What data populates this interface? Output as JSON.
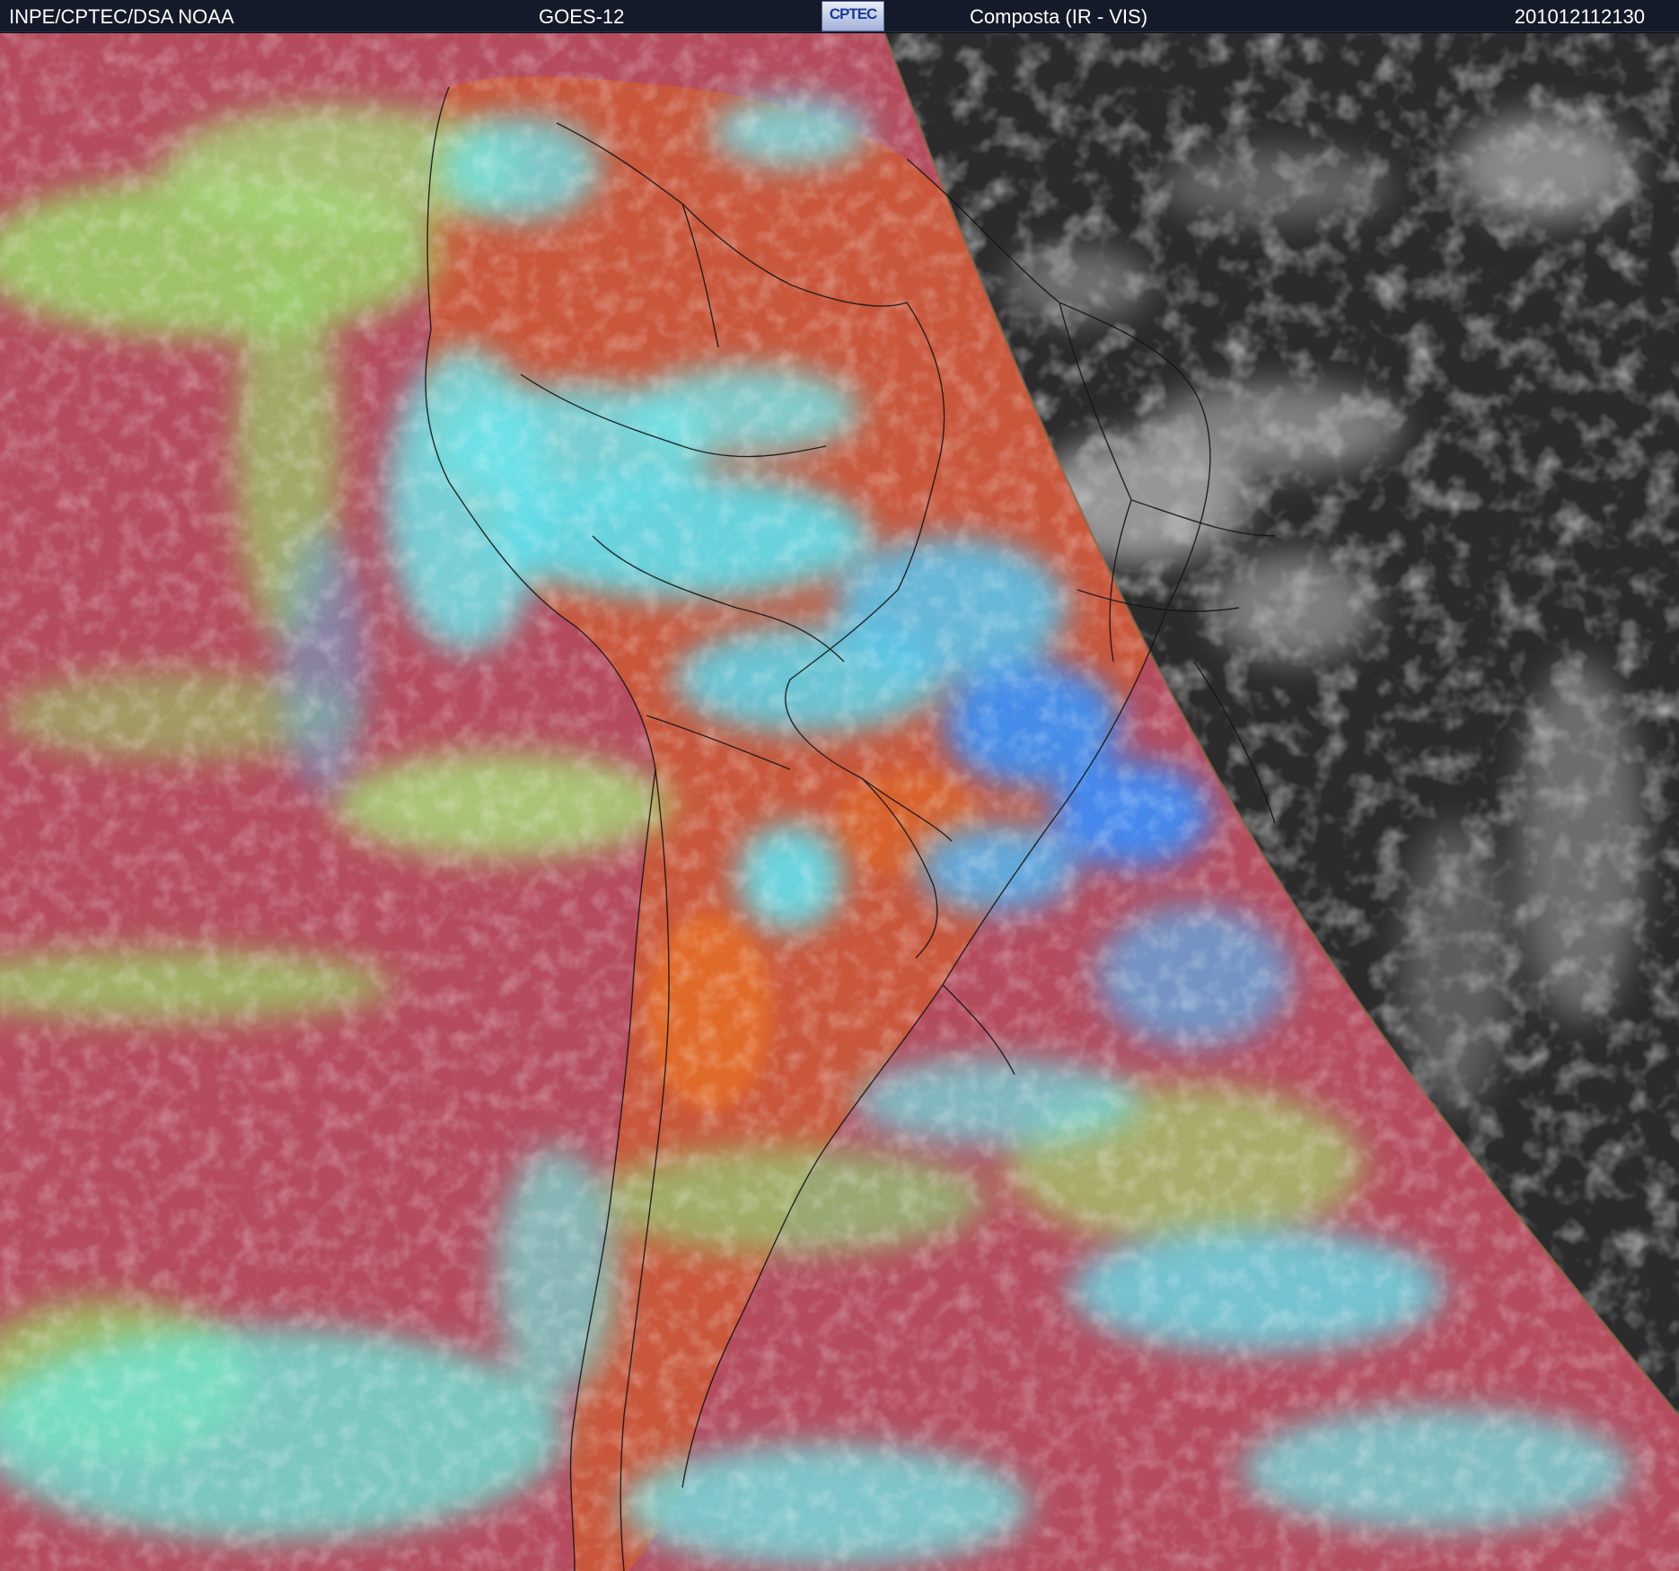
{
  "header": {
    "org_label": "INPE/CPTEC/DSA      NOAA",
    "satellite": "GOES-12",
    "product": "Composta (IR - VIS)",
    "timestamp": "201012112130"
  },
  "logo": {
    "text": "CPTEC"
  },
  "colors": {
    "header_bg": "#151a2a",
    "ocean_clear": "#b84a56",
    "land_clear": "#c8583e",
    "cloud_low": "#9ad86a",
    "cloud_mid": "#64e6e2",
    "cloud_high": "#4aa0f0",
    "night_side": "#2b2b2b",
    "night_cloud": "#bcbcbc",
    "borders": "#111111"
  }
}
